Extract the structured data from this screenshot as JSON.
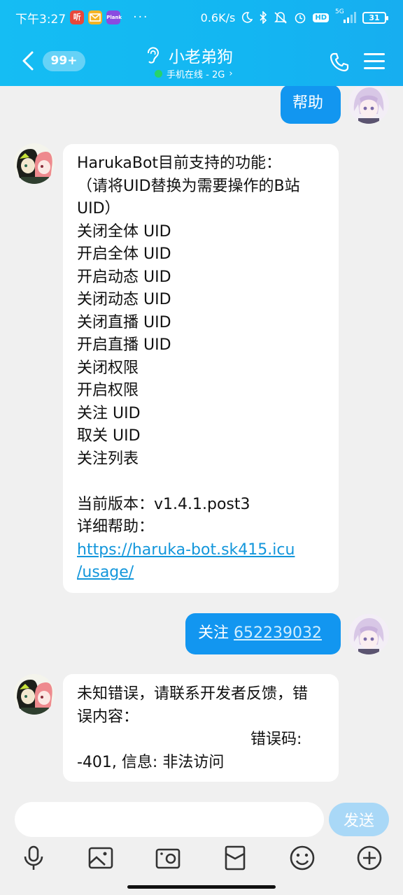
{
  "status_bar": {
    "time": "下午3:27",
    "app_icons": [
      {
        "name": "ting-app-icon",
        "text": "听",
        "color": "#e8473a"
      },
      {
        "name": "mail-app-icon",
        "text": "",
        "color": "#f5b323"
      },
      {
        "name": "plank-app-icon",
        "text": "Plank",
        "color": "#8a4be0"
      }
    ],
    "more": "···",
    "net_speed": "0.6K/s",
    "signal": "5G",
    "hd": "HD",
    "battery": "31"
  },
  "header": {
    "unread_badge": "99+",
    "title": "小老弟狗",
    "subtitle": "手机在线 - 2G",
    "subtitle_arrow": "›"
  },
  "messages": [
    {
      "side": "out",
      "lines": [
        "帮助"
      ]
    },
    {
      "side": "in",
      "lines": [
        "HarukaBot目前支持的功能：",
        "（请将UID替换为需要操作的B站",
        "UID）",
        "关闭全体 UID",
        "开启全体 UID",
        "开启动态 UID",
        "关闭动态 UID",
        "关闭直播 UID",
        "开启直播 UID",
        "关闭权限",
        "开启权限",
        "关注 UID",
        "取关 UID",
        "关注列表",
        "",
        "当前版本：v1.4.1.post3",
        "详细帮助："
      ],
      "link_lines": [
        "https://haruka-bot.sk415.icu",
        "/usage/"
      ]
    },
    {
      "side": "out",
      "prefix": "关注 ",
      "link": "652239032"
    },
    {
      "side": "in",
      "lines": [
        "未知错误，请联系开发者反馈，错",
        "误内容：",
        "错误码:",
        "-401, 信息: 非法访问"
      ]
    }
  ],
  "input": {
    "placeholder": "",
    "send_label": "发送"
  },
  "toolbar_icons": [
    "microphone-icon",
    "image-icon",
    "camera-icon",
    "red-packet-icon",
    "emoji-icon",
    "plus-icon"
  ],
  "colors": {
    "header": "#13b6f2",
    "bubble_out": "#1296f0",
    "bubble_in": "#ffffff",
    "link": "#1296db",
    "send_disabled": "#a9d8f7",
    "online_dot": "#27d36a"
  }
}
